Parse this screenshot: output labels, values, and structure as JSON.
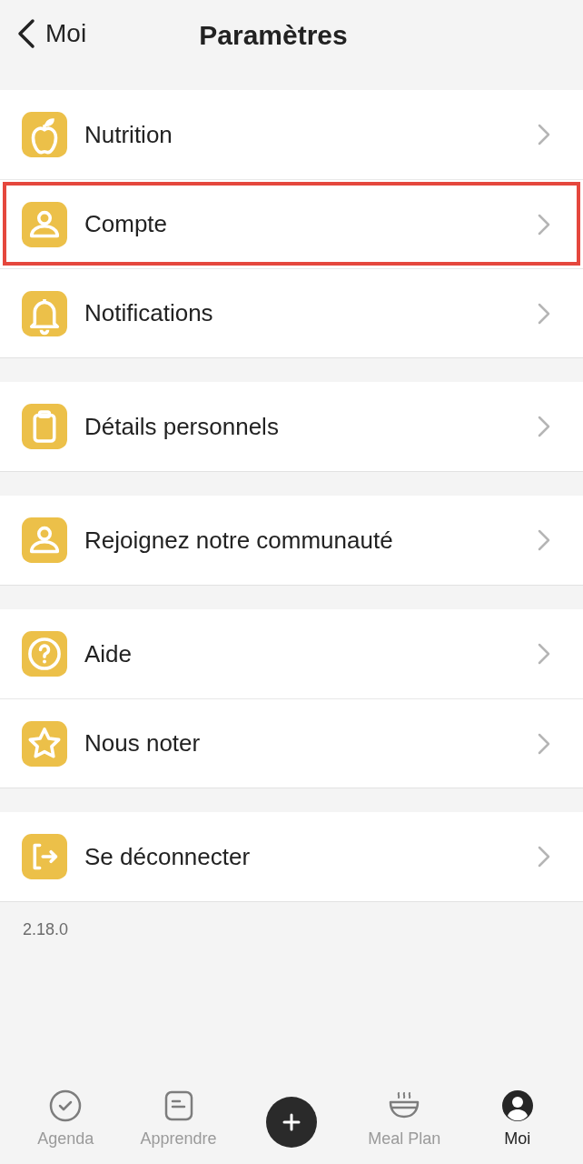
{
  "header": {
    "back_label": "Moi",
    "title": "Paramètres"
  },
  "groups": [
    {
      "items": [
        {
          "kind": "apple",
          "label": "Nutrition",
          "highlighted": false
        },
        {
          "kind": "person",
          "label": "Compte",
          "highlighted": true
        },
        {
          "kind": "bell",
          "label": "Notifications",
          "highlighted": false
        }
      ]
    },
    {
      "items": [
        {
          "kind": "clipboard",
          "label": "Détails personnels",
          "highlighted": false
        }
      ]
    },
    {
      "items": [
        {
          "kind": "person",
          "label": "Rejoignez notre communauté",
          "highlighted": false
        }
      ]
    },
    {
      "items": [
        {
          "kind": "help",
          "label": "Aide",
          "highlighted": false
        },
        {
          "kind": "star",
          "label": "Nous noter",
          "highlighted": false
        }
      ]
    },
    {
      "items": [
        {
          "kind": "logout",
          "label": "Se déconnecter",
          "highlighted": false
        }
      ]
    }
  ],
  "version": "2.18.0",
  "tab_bar": [
    {
      "kind": "check",
      "label": "Agenda",
      "selected": false
    },
    {
      "kind": "note",
      "label": "Apprendre",
      "selected": false
    },
    {
      "kind": "plus",
      "selected": false
    },
    {
      "kind": "bowl",
      "label": "Meal Plan",
      "selected": false
    },
    {
      "kind": "avatar",
      "label": "Moi",
      "selected": true
    }
  ]
}
